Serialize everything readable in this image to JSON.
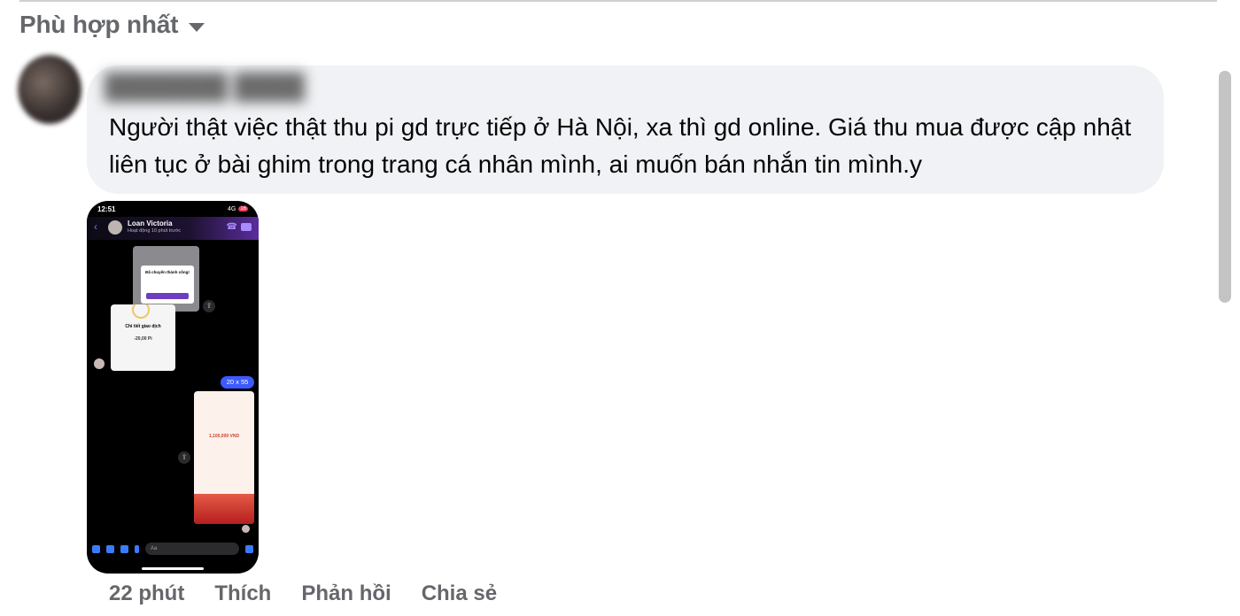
{
  "sort": {
    "label": "Phù hợp nhất",
    "icon": "caret-down-icon"
  },
  "comment": {
    "text": "Người thật việc thật thu pi gd trực tiếp ở Hà Nội, xa thì gd online. Giá thu mua được cập nhật liên tục ở bài ghim trong trang cá nhân mình, ai muốn bán nhắn tin mình.y",
    "attachment": {
      "status_time": "12:51",
      "network": "4G",
      "battery": "16",
      "contact_name": "Loan Victoria",
      "contact_status": "Hoạt động 10 phút trước",
      "dialog_title": "Đã chuyển thành công!",
      "card_title": "Chi tiết giao dịch",
      "card_amount": "-20,00 Pi",
      "sent_message": "20 x 55",
      "transfer_amount": "1,100,000 VND",
      "input_placeholder": "Aa"
    }
  },
  "actions": {
    "time": "22 phút",
    "like": "Thích",
    "reply": "Phản hồi",
    "share": "Chia sẻ"
  },
  "colors": {
    "bubble": "#f0f2f5",
    "muted_text": "#65676b",
    "accent": "#3d5afe"
  }
}
